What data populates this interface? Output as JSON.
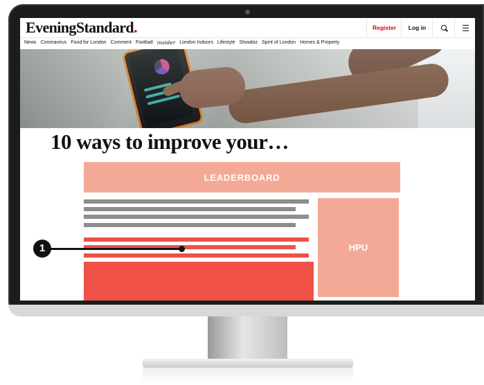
{
  "site": {
    "logo_text": "EveningStandard",
    "logo_dot": ".",
    "register_label": "Register",
    "login_label": "Log in",
    "search_icon": "search-icon",
    "menu_icon": "menu-icon"
  },
  "nav": {
    "items": [
      "News",
      "Coronavirus",
      "Food for London",
      "Comment",
      "Football",
      "insider",
      "London Indoors",
      "Lifestyle",
      "Showbiz",
      "Spirit of London",
      "Homes & Property"
    ]
  },
  "article": {
    "headline": "10 ways to improve your…"
  },
  "ads": {
    "leaderboard_label": "LEADERBOARD",
    "hpu_label": "HPU"
  },
  "callout": {
    "number": "1"
  },
  "colors": {
    "brand_red": "#d0021b",
    "ad_salmon": "#f4a996",
    "highlight_red": "#ef5147",
    "text_gray": "#8e8c8c"
  }
}
